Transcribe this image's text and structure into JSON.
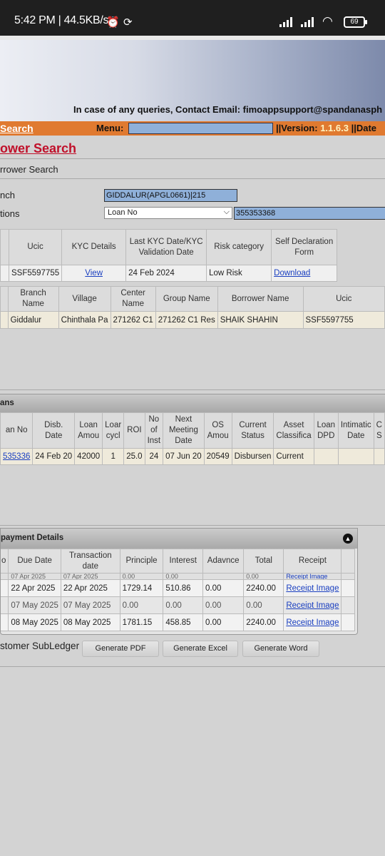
{
  "status_bar": {
    "time": "5:42 PM | 44.5KB/s",
    "battery": "69",
    "icons": [
      "alarm-icon",
      "sync-icon",
      "signal-icon",
      "signal-icon",
      "wifi-icon",
      "battery-icon"
    ]
  },
  "header": {
    "query_text": "In case of any queries, Contact Email: fimoappsupport@spandanasph",
    "search_link": "Search",
    "menu_label": "Menu:",
    "version_prefix": "||Version: ",
    "version_value": "1.1.6.3",
    "date_label": " ||Date"
  },
  "page": {
    "title": "ower Search",
    "subtitle": "rrower Search"
  },
  "form": {
    "branch_label": "nch",
    "branch_value": "GIDDALUR(APGL0661)|215",
    "options_label": "tions",
    "select_value": "Loan No",
    "search_value": "355353368"
  },
  "kyc_table": {
    "headers": [
      "",
      "Ucic",
      "KYC Details",
      "Last KYC Date/KYC Validation Date",
      "Risk category",
      "Self Declaration Form"
    ],
    "row": [
      "",
      "SSF5597755",
      "View",
      "24 Feb 2024",
      "Low Risk",
      "Download"
    ]
  },
  "customer_table": {
    "headers": [
      "",
      "Branch Name",
      "Village",
      "Center Name",
      "Group Name",
      "Borrower Name",
      "Ucic"
    ],
    "row": [
      "",
      "Giddalur",
      "Chinthala Pa",
      "271262 C1",
      "271262 C1 Res",
      "SHAIK SHAHIN",
      "SSF5597755"
    ]
  },
  "loans_section": {
    "title": "ans",
    "headers": [
      "an No",
      "Disb. Date",
      "Loan Amou",
      "Loar cycl",
      "ROI",
      "No of Inst",
      "Next Meeting Date",
      "OS Amou",
      "Current Status",
      "Asset Classifica",
      "Loan DPD",
      "Intimatic Date",
      "C S"
    ],
    "row": [
      "535336",
      "24 Feb 20",
      "42000",
      "1",
      "25.0",
      "24",
      "07 Jun 20",
      "20549",
      "Disbursen",
      "Current",
      "",
      "",
      ""
    ]
  },
  "repayment": {
    "title": "payment Details",
    "headers": [
      "o",
      "Due Date",
      "Transaction date",
      "Principle",
      "Interest",
      "Adavnce",
      "Total",
      "Receipt"
    ],
    "partial_row": [
      "",
      "07 Apr 2025",
      "07 Apr 2025",
      "0.00",
      "0.00",
      "",
      "0.00",
      "Receipt Image"
    ],
    "rows": [
      [
        "",
        "22 Apr 2025",
        "22 Apr 2025",
        "1729.14",
        "510.86",
        "0.00",
        "2240.00",
        "Receipt Image"
      ],
      [
        "",
        "07 May 2025",
        "07 May 2025",
        "0.00",
        "0.00",
        "0.00",
        "0.00",
        "Receipt Image"
      ],
      [
        "",
        "08 May 2025",
        "08 May 2025",
        "1781.15",
        "458.85",
        "0.00",
        "2240.00",
        "Receipt Image"
      ]
    ]
  },
  "ledger": {
    "label": "stomer SubLedger",
    "buttons": [
      "Generate PDF",
      "Generate Excel",
      "Generate Word"
    ]
  }
}
